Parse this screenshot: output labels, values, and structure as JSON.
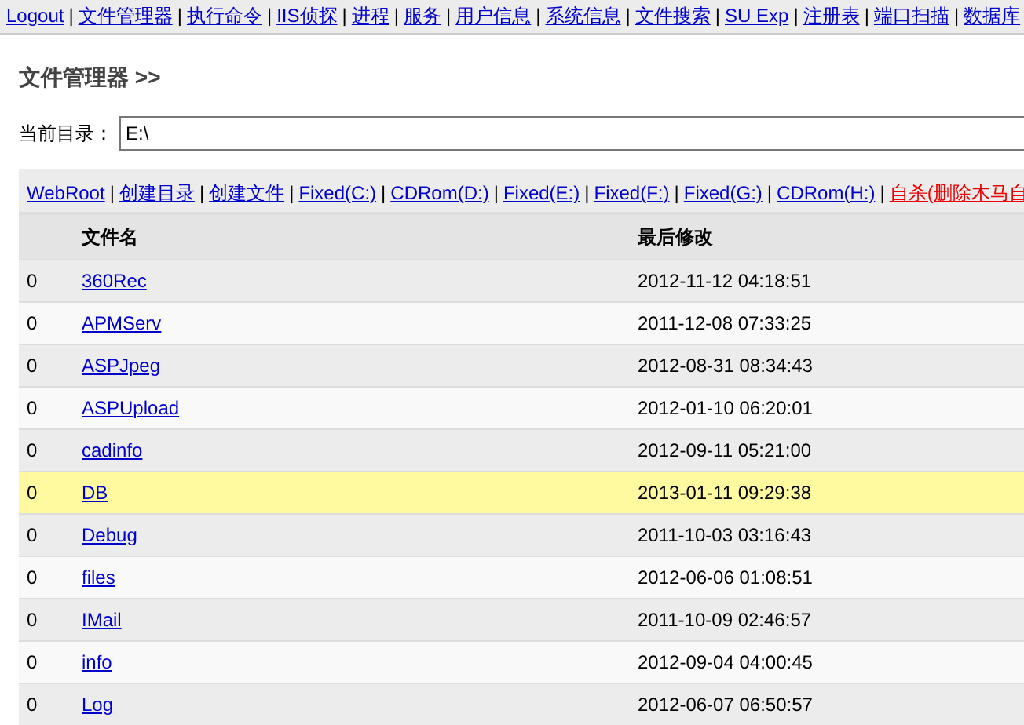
{
  "nav": {
    "separator": "|",
    "links": [
      "Logout",
      "文件管理器",
      "执行命令",
      "IIS侦探",
      "进程",
      "服务",
      "用户信息",
      "系统信息",
      "文件搜索",
      "SU Exp",
      "注册表",
      "端口扫描",
      "数据库"
    ]
  },
  "title": "文件管理器 >>",
  "current_dir": {
    "label": "当前目录：",
    "value": "E:\\"
  },
  "drives": {
    "separator": "|",
    "links": [
      {
        "text": "WebRoot",
        "kind": "normal"
      },
      {
        "text": "创建目录",
        "kind": "normal"
      },
      {
        "text": "创建文件",
        "kind": "normal"
      },
      {
        "text": "Fixed(C:)",
        "kind": "normal"
      },
      {
        "text": "CDRom(D:)",
        "kind": "normal"
      },
      {
        "text": "Fixed(E:)",
        "kind": "normal"
      },
      {
        "text": "Fixed(F:)",
        "kind": "normal"
      },
      {
        "text": "Fixed(G:)",
        "kind": "normal"
      },
      {
        "text": "CDRom(H:)",
        "kind": "normal"
      },
      {
        "text": "自杀(删除木马自",
        "kind": "danger"
      }
    ]
  },
  "table": {
    "columns": [
      "文件名",
      "最后修改"
    ],
    "rows": [
      {
        "mark": "0",
        "name": "360Rec",
        "modified": "2012-11-12 04:18:51",
        "selected": false
      },
      {
        "mark": "0",
        "name": "APMServ",
        "modified": "2011-12-08 07:33:25",
        "selected": false
      },
      {
        "mark": "0",
        "name": "ASPJpeg",
        "modified": "2012-08-31 08:34:43",
        "selected": false
      },
      {
        "mark": "0",
        "name": "ASPUpload",
        "modified": "2012-01-10 06:20:01",
        "selected": false
      },
      {
        "mark": "0",
        "name": "cadinfo",
        "modified": "2012-09-11 05:21:00",
        "selected": false
      },
      {
        "mark": "0",
        "name": "DB",
        "modified": "2013-01-11 09:29:38",
        "selected": true
      },
      {
        "mark": "0",
        "name": "Debug",
        "modified": "2011-10-03 03:16:43",
        "selected": false
      },
      {
        "mark": "0",
        "name": "files",
        "modified": "2012-06-06 01:08:51",
        "selected": false
      },
      {
        "mark": "0",
        "name": "IMail",
        "modified": "2011-10-09 02:46:57",
        "selected": false
      },
      {
        "mark": "0",
        "name": "info",
        "modified": "2012-09-04 04:00:45",
        "selected": false
      },
      {
        "mark": "0",
        "name": "Log",
        "modified": "2012-06-07 06:50:57",
        "selected": false
      }
    ]
  }
}
